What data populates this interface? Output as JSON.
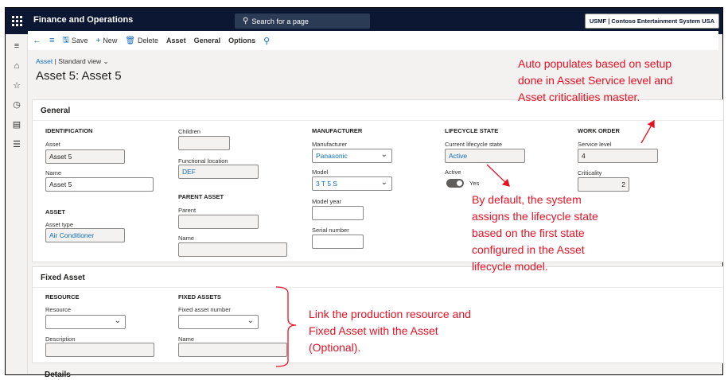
{
  "header": {
    "app_title": "Finance and Operations",
    "search_placeholder": "Search for a page",
    "company": "USMF | Contoso Entertainment System USA"
  },
  "rail": {
    "icons": [
      "menu-icon",
      "home-icon",
      "star-icon",
      "clock-icon",
      "workspace-icon",
      "list-icon"
    ]
  },
  "commands": {
    "save": "Save",
    "new": "New",
    "delete": "Delete",
    "asset": "Asset",
    "general": "General",
    "options": "Options"
  },
  "breadcrumb": {
    "link": "Asset",
    "separator": "|",
    "view": "Standard view"
  },
  "page_title": "Asset 5: Asset 5",
  "general": {
    "title": "General",
    "identification": {
      "title": "IDENTIFICATION",
      "asset_label": "Asset",
      "asset_value": "Asset 5",
      "name_label": "Name",
      "name_value": "Asset 5"
    },
    "asset": {
      "title": "ASSET",
      "type_label": "Asset type",
      "type_value": "Air Conditioner"
    },
    "children": {
      "label": "Children",
      "value": ""
    },
    "functional_location": {
      "label": "Functional location",
      "value": "DEF"
    },
    "parent_asset": {
      "title": "PARENT ASSET",
      "parent_label": "Parent",
      "parent_value": "",
      "name_label": "Name",
      "name_value": ""
    },
    "manufacturer": {
      "title": "MANUFACTURER",
      "manufacturer_label": "Manufacturer",
      "manufacturer_value": "Panasonic",
      "model_label": "Model",
      "model_value": "3 T 5 S",
      "model_year_label": "Model year",
      "model_year_value": "",
      "serial_label": "Serial number",
      "serial_value": ""
    },
    "lifecycle": {
      "title": "LIFECYCLE STATE",
      "current_label": "Current lifecycle state",
      "current_value": "Active",
      "active_label": "Active",
      "active_value": "Yes"
    },
    "work_order": {
      "title": "WORK ORDER",
      "service_label": "Service level",
      "service_value": "4",
      "criticality_label": "Criticality",
      "criticality_value": "2"
    }
  },
  "fixed_asset_section": {
    "title": "Fixed Asset",
    "resource": {
      "title": "RESOURCE",
      "resource_label": "Resource",
      "resource_value": "",
      "description_label": "Description",
      "description_value": ""
    },
    "fixed_assets": {
      "title": "FIXED ASSETS",
      "number_label": "Fixed asset number",
      "number_value": "",
      "name_label": "Name",
      "name_value": ""
    }
  },
  "details_peek": "Details",
  "annotations": {
    "color": "#e81123",
    "work_order_note": [
      "Auto populates based on setup",
      "done in Asset Service level and",
      "Asset criticalities master."
    ],
    "lifecycle_note": [
      "By default, the system",
      "assigns the lifecycle state",
      "based on the first state",
      "configured in the Asset",
      "lifecycle model."
    ],
    "fixed_asset_note": [
      "Link the production resource and",
      "Fixed Asset with the Asset",
      "(Optional)."
    ]
  }
}
